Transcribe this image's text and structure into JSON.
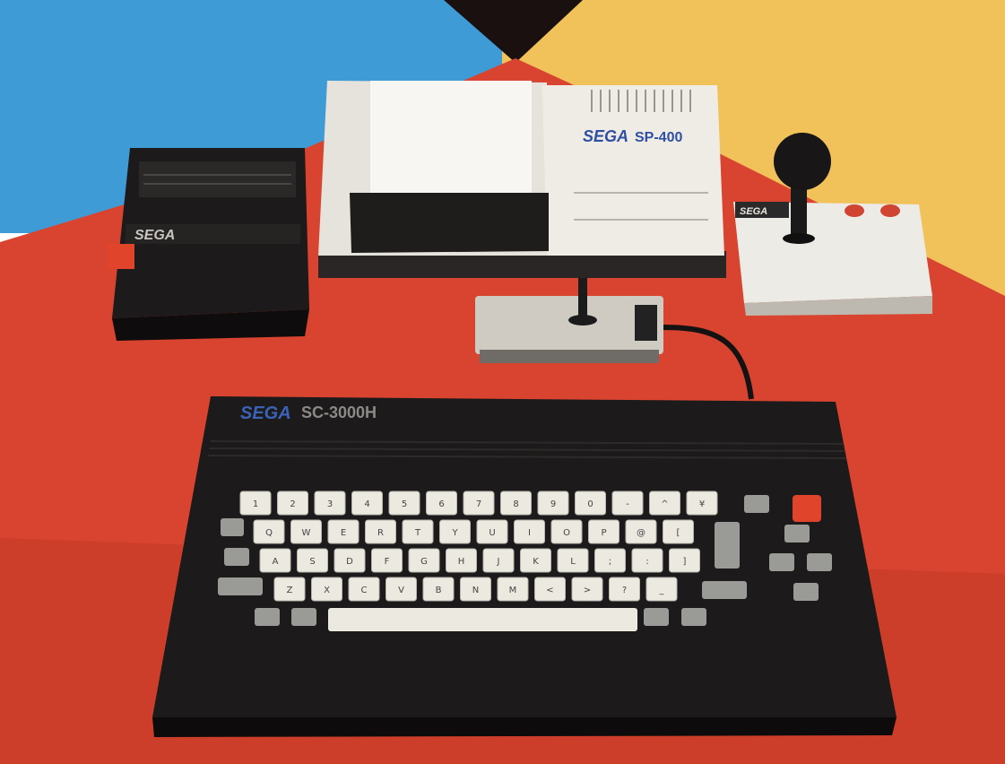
{
  "colors": {
    "backdrop_left": "#3e9bd6",
    "backdrop_right": "#f2c25a",
    "table": "#d8442f",
    "table_dark": "#a8301f",
    "black_plastic": "#1c1a1a",
    "cream_plastic": "#e9e6df",
    "key_cream": "#ece9e1",
    "key_grey": "#9a9a96",
    "accent_red": "#e0452c"
  },
  "printer": {
    "brand": "SEGA",
    "model": "SP-400"
  },
  "keyboard": {
    "brand": "SEGA",
    "model": "SC-3000H",
    "row1": [
      "1",
      "2",
      "3",
      "4",
      "5",
      "6",
      "7",
      "8",
      "9",
      "0",
      "-",
      "^",
      "¥"
    ],
    "row2": [
      "Q",
      "W",
      "E",
      "R",
      "T",
      "Y",
      "U",
      "I",
      "O",
      "P",
      "@",
      "["
    ],
    "row3": [
      "A",
      "S",
      "D",
      "F",
      "G",
      "H",
      "J",
      "K",
      "L",
      ";",
      ":",
      "]"
    ],
    "row4": [
      "Z",
      "X",
      "C",
      "V",
      "B",
      "N",
      "M",
      "<",
      ">",
      "?",
      "_"
    ]
  },
  "tape_deck": {
    "brand": "SEGA"
  },
  "joystick": {
    "brand": "SEGA"
  }
}
